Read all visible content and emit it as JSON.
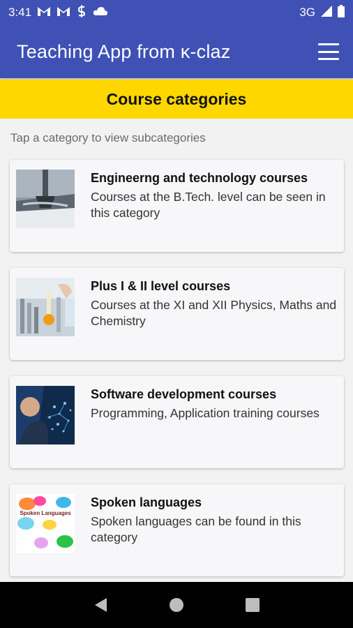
{
  "status": {
    "time": "3:41",
    "notif_icons": [
      "gmail-icon",
      "gmail-icon",
      "sync-icon",
      "cloud-icon"
    ],
    "network": "3G"
  },
  "app_bar": {
    "title": "Teaching App from ĸ-claz",
    "menu_icon": "hamburger-menu-icon"
  },
  "header": {
    "title": "Course categories"
  },
  "hint": "Tap a category to view subcategories",
  "categories": [
    {
      "title": "Engineerng and technology courses",
      "description": "Courses at the B.Tech. level can be seen in this category",
      "image": "engineering-image"
    },
    {
      "title": "Plus I & II level courses",
      "description": "Courses at the XI and XII Physics, Maths and Chemistry",
      "image": "lab-science-image"
    },
    {
      "title": "Software development courses",
      "description": "Programming, Application training courses",
      "image": "software-image"
    },
    {
      "title": "Spoken languages",
      "description": "Spoken languages can be found in this category",
      "image": "spoken-languages-image",
      "image_text": "Spoken Languages"
    }
  ],
  "colors": {
    "primary": "#3f51b5",
    "header": "#ffd700",
    "card": "#f7f7f9",
    "background": "#f2f2f2"
  }
}
